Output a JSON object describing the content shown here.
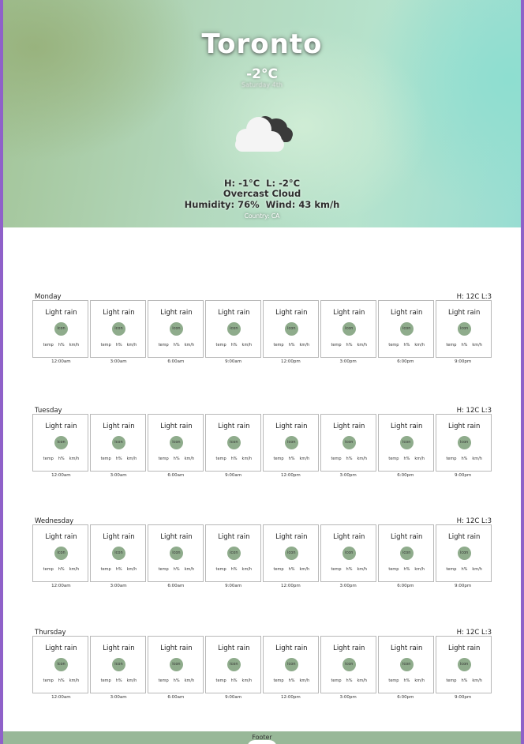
{
  "hero": {
    "city": "Toronto",
    "temp": "-2°C",
    "date": "Saturday 4th",
    "high": "H: -1°C",
    "low": "L: -2°C",
    "condition": "Overcast Cloud",
    "humidity": "Humidity: 76%",
    "wind": "Wind: 43 km/h",
    "country": "Country: CA",
    "icon": "cloudy-icon"
  },
  "days": [
    {
      "name": "Monday",
      "hl": "H: 12C L:3"
    },
    {
      "name": "Tuesday",
      "hl": "H: 12C L:3"
    },
    {
      "name": "Wednesday",
      "hl": "H: 12C L:3"
    },
    {
      "name": "Thursday",
      "hl": "H: 12C L:3"
    }
  ],
  "card": {
    "description": "Light rain",
    "icon_label": "icon",
    "temp": "temp",
    "humidity": "h%",
    "wind": "km/h"
  },
  "times": [
    "12:00am",
    "3:00am",
    "6:00am",
    "9:00am",
    "12:00pm",
    "3:00pm",
    "6:00pm",
    "9:00pm"
  ],
  "footer": {
    "label": "Footer"
  },
  "colors": {
    "accent": "#8fac8c",
    "border": "#8f61c9",
    "footer": "#98b898"
  }
}
